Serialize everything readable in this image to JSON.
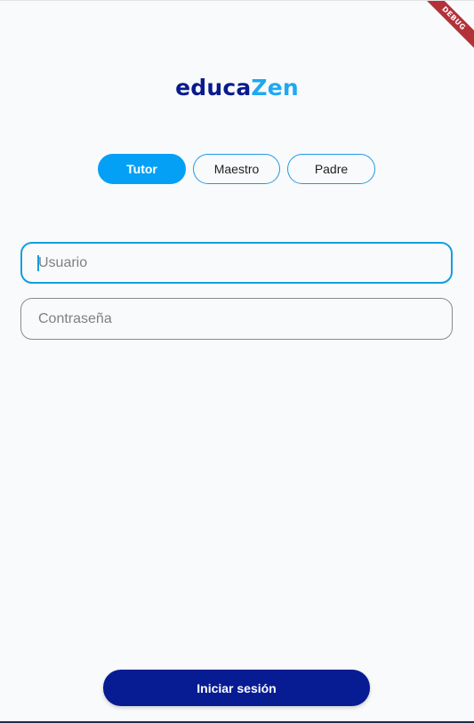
{
  "logo": {
    "part_a": "educa",
    "part_b": "Zen",
    "color_a": "#0a1a8e",
    "color_b": "#1ea8f2"
  },
  "roles": {
    "selected": "Tutor",
    "tutor_label": "Tutor",
    "maestro_label": "Maestro",
    "padre_label": "Padre"
  },
  "form": {
    "usuario_placeholder": "Usuario",
    "contrasena_placeholder": "Contraseña"
  },
  "submit": {
    "label": "Iniciar sesión"
  },
  "debug_banner": {
    "label": "DEBUG"
  },
  "colors": {
    "accent": "#04a0f6",
    "primary": "#071c93",
    "debug": "#b3323a"
  }
}
